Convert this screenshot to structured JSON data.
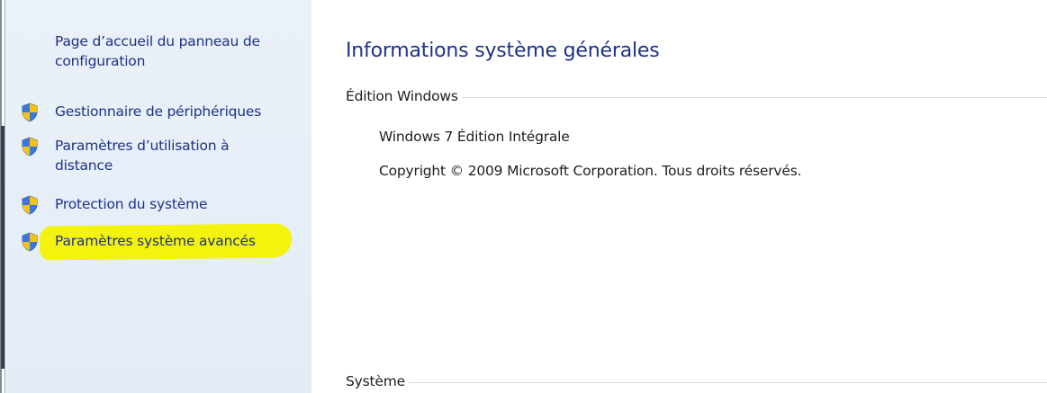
{
  "sidebar": {
    "home_link": "Page d’accueil du panneau de configuration",
    "items": [
      {
        "label": "Gestionnaire de périphériques",
        "icon": "uac-shield-icon"
      },
      {
        "label": "Paramètres d’utilisation à distance",
        "icon": "uac-shield-icon"
      },
      {
        "label": "Protection du système",
        "icon": "uac-shield-icon"
      },
      {
        "label": "Paramètres système avancés",
        "icon": "uac-shield-icon",
        "highlighted": true
      }
    ]
  },
  "main": {
    "title": "Informations système générales",
    "windows_edition": {
      "header": "Édition Windows",
      "edition": "Windows 7 Édition Intégrale",
      "copyright": "Copyright © 2009 Microsoft Corporation. Tous droits réservés."
    },
    "system": {
      "header": "Système"
    }
  },
  "colors": {
    "link": "#1e3287",
    "sidebar_bg": "#e3ecf6",
    "highlight": "#f3f200",
    "text": "#1e1e1e"
  }
}
